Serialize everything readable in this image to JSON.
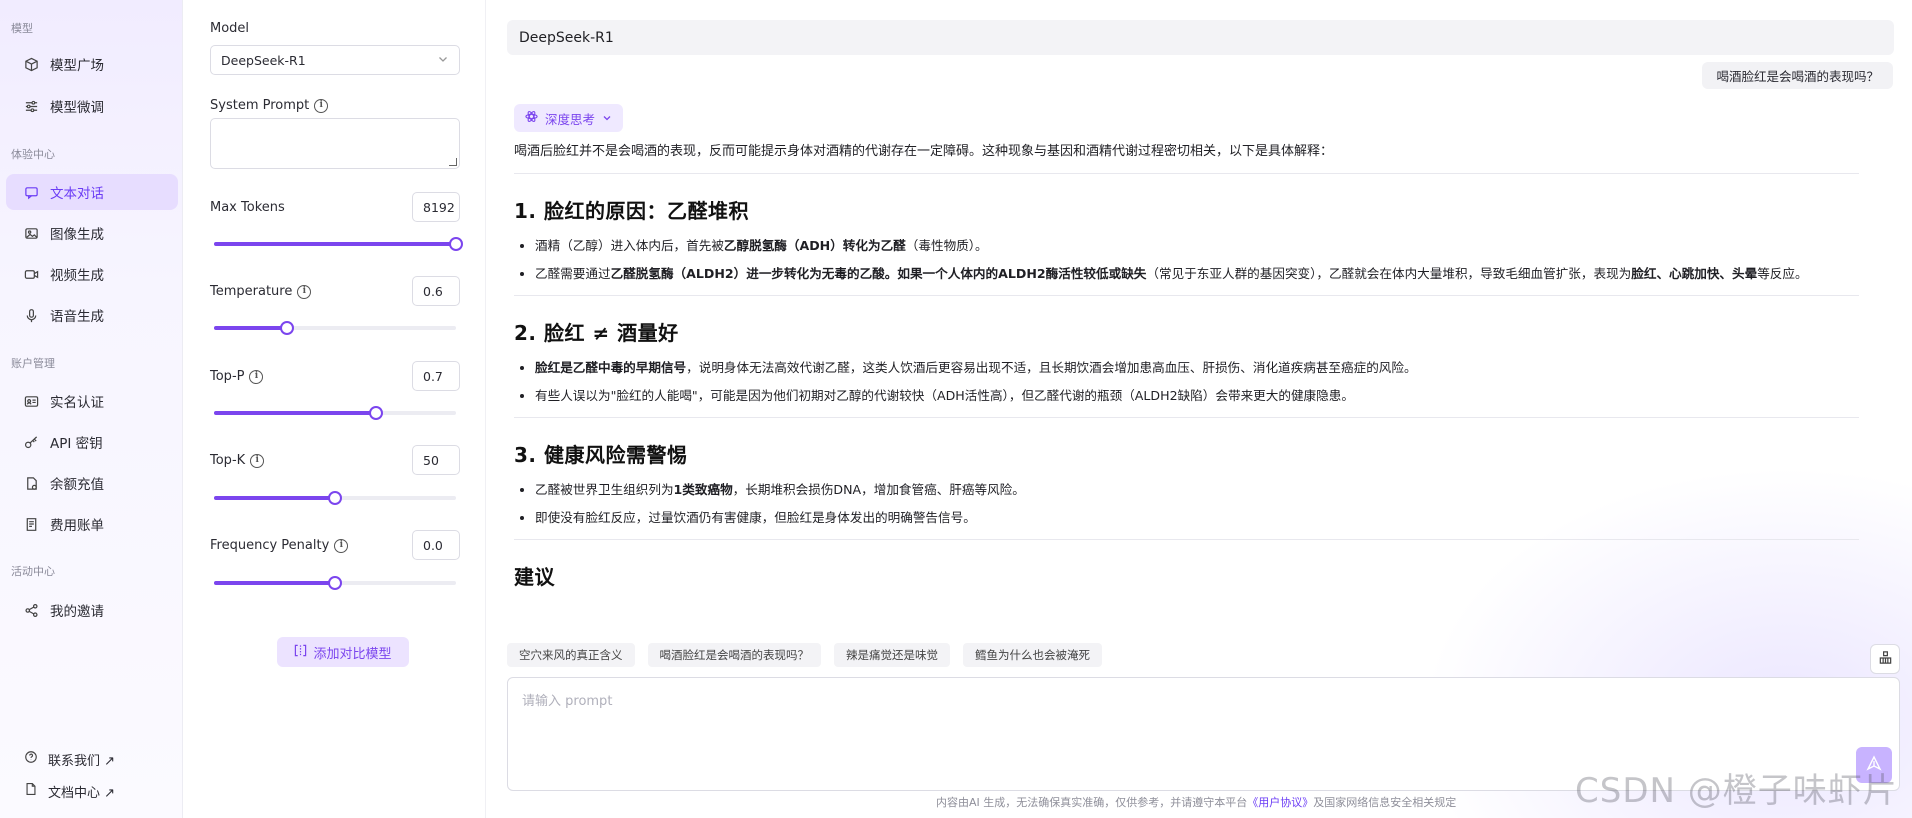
{
  "sidebar": {
    "groups": [
      "模型",
      "体验中心",
      "账户管理",
      "活动中心"
    ],
    "items": [
      {
        "label": "模型广场",
        "icon": "cube-icon"
      },
      {
        "label": "模型微调",
        "icon": "sliders-icon"
      },
      {
        "label": "文本对话",
        "icon": "chat-icon",
        "active": true
      },
      {
        "label": "图像生成",
        "icon": "image-icon"
      },
      {
        "label": "视频生成",
        "icon": "video-icon"
      },
      {
        "label": "语音生成",
        "icon": "mic-icon"
      },
      {
        "label": "实名认证",
        "icon": "id-card-icon"
      },
      {
        "label": "API 密钥",
        "icon": "key-icon"
      },
      {
        "label": "余额充值",
        "icon": "wallet-icon"
      },
      {
        "label": "费用账单",
        "icon": "bill-icon"
      },
      {
        "label": "我的邀请",
        "icon": "share-icon"
      }
    ],
    "bottom": [
      {
        "label": "联系我们 ↗",
        "icon": "contact-icon"
      },
      {
        "label": "文档中心 ↗",
        "icon": "doc-icon"
      }
    ]
  },
  "params": {
    "model_label": "Model",
    "model_value": "DeepSeek-R1",
    "system_prompt_label": "System Prompt",
    "max_tokens": {
      "label": "Max Tokens",
      "value": "8192",
      "fraction": 1.0
    },
    "temperature": {
      "label": "Temperature",
      "value": "0.6",
      "fraction": 0.3
    },
    "top_p": {
      "label": "Top-P",
      "value": "0.7",
      "fraction": 0.67
    },
    "top_k": {
      "label": "Top-K",
      "value": "50",
      "fraction": 0.5
    },
    "frequency_penalty": {
      "label": "Frequency Penalty",
      "value": "0.0",
      "fraction": 0.5
    },
    "add_compare_label": "添加对比模型"
  },
  "chat": {
    "model_name": "DeepSeek-R1",
    "user_message": "喝酒脸红是会喝酒的表现吗？",
    "think_label": "深度思考",
    "intro": "喝酒后脸红并不是会喝酒的表现，反而可能提示身体对酒精的代谢存在一定障碍。这种现象与基因和酒精代谢过程密切相关，以下是具体解释：",
    "s1": {
      "title": "1. 脸红的原因：乙醛堆积",
      "b1": [
        "酒精（乙醇）进入体内后，首先被",
        "乙醇脱氢酶（ADH）转化为乙醛",
        "（毒性物质）。"
      ],
      "b2": [
        "乙醛需要通过",
        "乙醛脱氢酶（ALDH2）进一步转化为无毒的乙酸。如果一个人体内的ALDH2酶活性较低或缺失",
        "（常见于东亚人群的基因突变），乙醛就会在体内大量堆积，导致毛细血管扩张，表现为",
        "脸红、心跳加快、头晕",
        "等反应。"
      ]
    },
    "s2": {
      "title": "2. 脸红 ≠ 酒量好",
      "b1": [
        "脸红是乙醛中毒的早期信号",
        "，说明身体无法高效代谢乙醛，这类人饮酒后更容易出现不适，且长期饮酒会增加患高血压、肝损伤、消化道疾病甚至癌症的风险。"
      ],
      "b2": "有些人误以为\"脸红的人能喝\"，可能是因为他们初期对乙醇的代谢较快（ADH活性高），但乙醛代谢的瓶颈（ALDH2缺陷）会带来更大的健康隐患。"
    },
    "s3": {
      "title": "3. 健康风险需警惕",
      "b1": [
        "乙醛被世界卫生组织列为",
        "1类致癌物",
        "，长期堆积会损伤DNA，增加食管癌、肝癌等风险。"
      ],
      "b2": "即使没有脸红反应，过量饮酒仍有害健康，但脸红是身体发出的明确警告信号。"
    },
    "suggest_title": "建议",
    "suggestions": [
      "空穴来风的真正含义",
      "喝酒脸红是会喝酒的表现吗？",
      "辣是痛觉还是味觉",
      "鳕鱼为什么也会被淹死"
    ],
    "prompt_placeholder": "请输入 prompt",
    "disclaimer_pre": "内容由AI 生成，无法确保真实准确，仅供参考，并请遵守本平台",
    "disclaimer_link": "《用户协议》",
    "disclaimer_post": "及国家网络信息安全相关规定"
  },
  "watermark": "CSDN @橙子味虾片",
  "colors": {
    "accent": "#7b45ee",
    "active_bg": "#e7ddff",
    "send_btn": "#c8b3ff"
  }
}
